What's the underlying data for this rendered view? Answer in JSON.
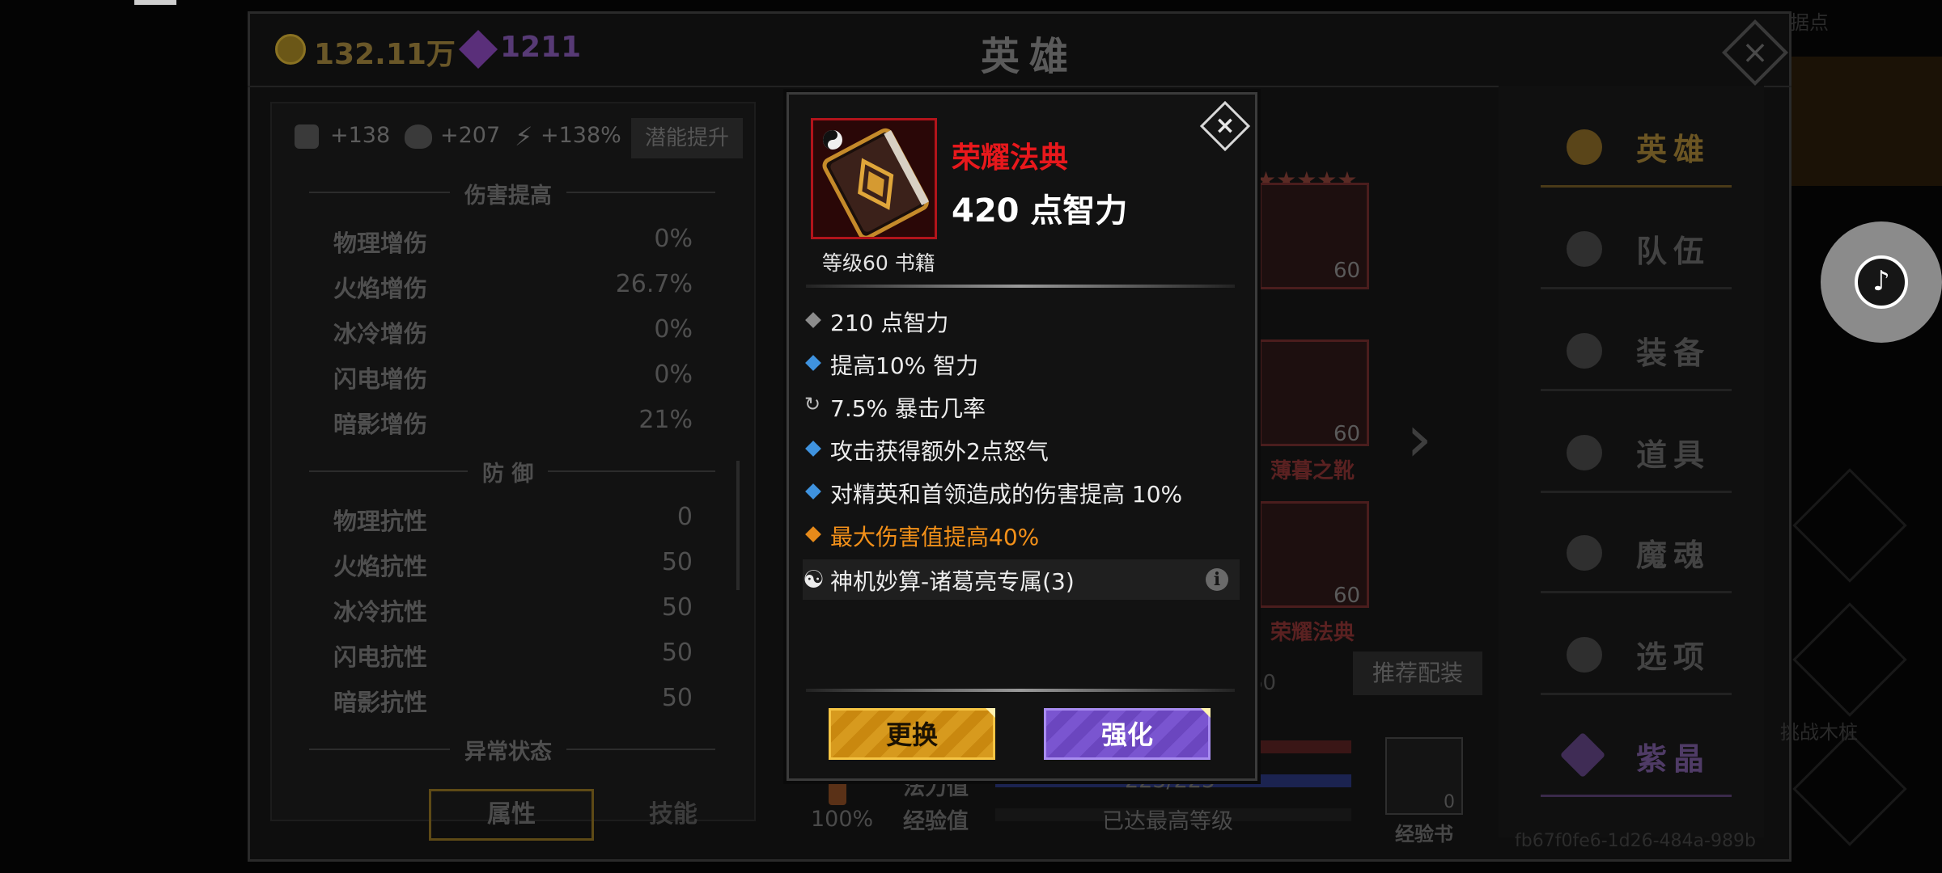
{
  "header": {
    "gold": "132.11万",
    "gems": "1211",
    "title": "英雄"
  },
  "stats": {
    "power": "+138",
    "health": "+207",
    "speed": "+138%",
    "potential_button": "潜能提升",
    "damage_section": "伤害提高",
    "damage": [
      {
        "name": "物理增伤",
        "value": "0%"
      },
      {
        "name": "火焰增伤",
        "value": "26.7%"
      },
      {
        "name": "冰冷增伤",
        "value": "0%"
      },
      {
        "name": "闪电增伤",
        "value": "0%"
      },
      {
        "name": "暗影增伤",
        "value": "21%"
      }
    ],
    "defense_section": "防 御",
    "defense": [
      {
        "name": "物理抗性",
        "value": "0"
      },
      {
        "name": "火焰抗性",
        "value": "50"
      },
      {
        "name": "冰冷抗性",
        "value": "50"
      },
      {
        "name": "闪电抗性",
        "value": "50"
      },
      {
        "name": "暗影抗性",
        "value": "50"
      }
    ],
    "status_section": "异常状态",
    "tab_attributes": "属性",
    "tab_skills": "技能"
  },
  "hero": {
    "slots": [
      {
        "level": "60",
        "name": ""
      },
      {
        "level": "60",
        "name": "薄暮之靴"
      },
      {
        "level": "60",
        "name": "荣耀法典"
      }
    ],
    "partial_level": "60",
    "recommend_button": "推荐配装",
    "mana_label": "法力值",
    "mana_value": "225/225",
    "exp_label": "经验值",
    "exp_value": "已达最高等级",
    "potion_percent": "100%",
    "exp_book_label": "经验书",
    "exp_book_count": "0"
  },
  "menu": {
    "items": [
      "英雄",
      "队伍",
      "装备",
      "道具",
      "魔魂",
      "选项",
      "紫晶"
    ]
  },
  "uuid": "fb67f0fe6-1d26-484a-989b",
  "overlay": {
    "tiktok_glyph": "♪",
    "ghost_top": "据点",
    "ghost_bottom": "挑战木桩"
  },
  "item": {
    "name": "荣耀法典",
    "main_stat": "420 点智力",
    "level_type": "等级60 书籍",
    "close": "×",
    "affixes": [
      {
        "text": "210 点智力",
        "bullet": "grey"
      },
      {
        "text": "提高10% 智力",
        "bullet": "blue"
      },
      {
        "text": "7.5% 暴击几率",
        "bullet": "reroll"
      },
      {
        "text": "攻击获得额外2点怒气",
        "bullet": "blue"
      },
      {
        "text": "对精英和首领造成的伤害提高 10%",
        "bullet": "blue"
      },
      {
        "text": "最大伤害值提高40%",
        "bullet": "orange"
      }
    ],
    "set_bonus": "神机妙算-诸葛亮专属(3)",
    "set_icon": "☯",
    "replace_button": "更换",
    "enhance_button": "强化"
  },
  "colors": {
    "legendary_name": "#e8181c",
    "orange_affix": "#f29019",
    "blue_bullet": "#3f93df",
    "replace_gold": "#d79a1e",
    "enhance_purple": "#7a55d0"
  }
}
